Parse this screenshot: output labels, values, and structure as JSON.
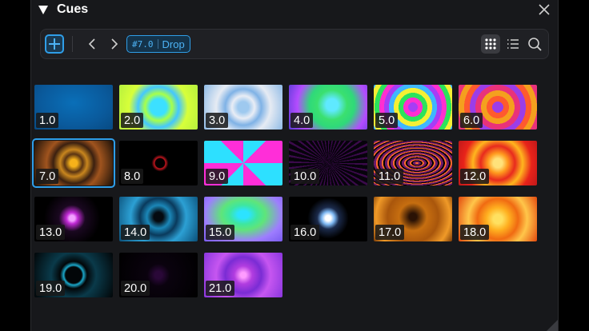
{
  "panel": {
    "title": "Cues",
    "collapse_icon": "triangle-down-icon",
    "close_icon": "close-icon"
  },
  "toolbar": {
    "add_icon": "plus-icon",
    "prev_icon": "chevron-left-icon",
    "next_icon": "chevron-right-icon",
    "current_cue_number": "#7.0",
    "current_cue_name": "Drop",
    "grid_view_icon": "grid-view-icon",
    "list_view_icon": "list-view-icon",
    "search_icon": "search-icon"
  },
  "colors": {
    "accent": "#2f9ee8",
    "panel_bg": "#17181b"
  },
  "cues": [
    {
      "label": "1.0",
      "selected": false
    },
    {
      "label": "2.0",
      "selected": false
    },
    {
      "label": "3.0",
      "selected": false
    },
    {
      "label": "4.0",
      "selected": false
    },
    {
      "label": "5.0",
      "selected": false
    },
    {
      "label": "6.0",
      "selected": false
    },
    {
      "label": "7.0",
      "selected": true
    },
    {
      "label": "8.0",
      "selected": false
    },
    {
      "label": "9.0",
      "selected": false
    },
    {
      "label": "10.0",
      "selected": false
    },
    {
      "label": "11.0",
      "selected": false
    },
    {
      "label": "12.0",
      "selected": false
    },
    {
      "label": "13.0",
      "selected": false
    },
    {
      "label": "14.0",
      "selected": false
    },
    {
      "label": "15.0",
      "selected": false
    },
    {
      "label": "16.0",
      "selected": false
    },
    {
      "label": "17.0",
      "selected": false
    },
    {
      "label": "18.0",
      "selected": false
    },
    {
      "label": "19.0",
      "selected": false
    },
    {
      "label": "20.0",
      "selected": false
    },
    {
      "label": "21.0",
      "selected": false
    }
  ]
}
